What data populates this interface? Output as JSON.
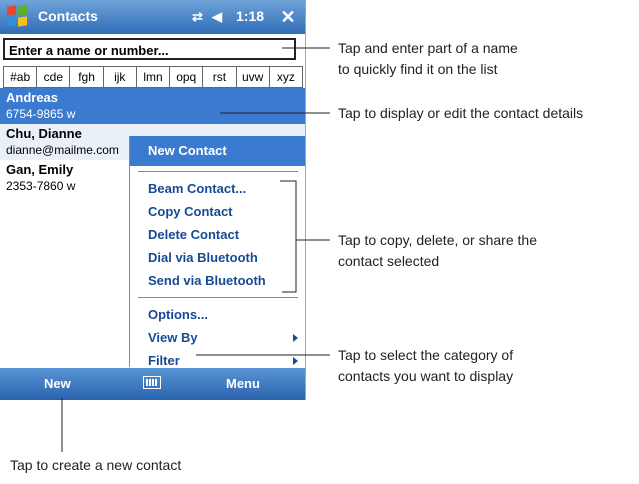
{
  "window": {
    "title": "Contacts",
    "clock": "1:18",
    "tray_icons": [
      "connectivity-icon",
      "speaker-icon"
    ],
    "close_label": "✕"
  },
  "search": {
    "value": "Enter a name or number..."
  },
  "index_tabs": [
    "#ab",
    "cde",
    "fgh",
    "ijk",
    "lmn",
    "opq",
    "rst",
    "uvw",
    "xyz"
  ],
  "contacts": [
    {
      "name": "Andreas",
      "detail": "6754-9865   w"
    },
    {
      "name": "Chu, Dianne",
      "detail": "dianne@mailme.com"
    },
    {
      "name": "Gan, Emily",
      "detail": "2353-7860   w"
    }
  ],
  "menu": {
    "header": "New Contact",
    "group1": [
      "Beam Contact...",
      "Copy Contact",
      "Delete Contact",
      "Dial via Bluetooth",
      "Send via Bluetooth"
    ],
    "group2": [
      "Options...",
      "View By",
      "Filter"
    ]
  },
  "bottom_bar": {
    "left": "New",
    "right": "Menu",
    "center_icon": "keyboard-icon"
  },
  "annotations": {
    "search": "Tap and enter part of a name\nto quickly find it on the list",
    "contact": "Tap to display or edit the contact details",
    "menu": "Tap to copy, delete, or share the\ncontact selected",
    "filter": "Tap to select the category of\ncontacts you want to display",
    "new": "Tap to create a new contact"
  },
  "colors": {
    "accent": "#3a7bd0",
    "menu_text": "#174a94"
  }
}
